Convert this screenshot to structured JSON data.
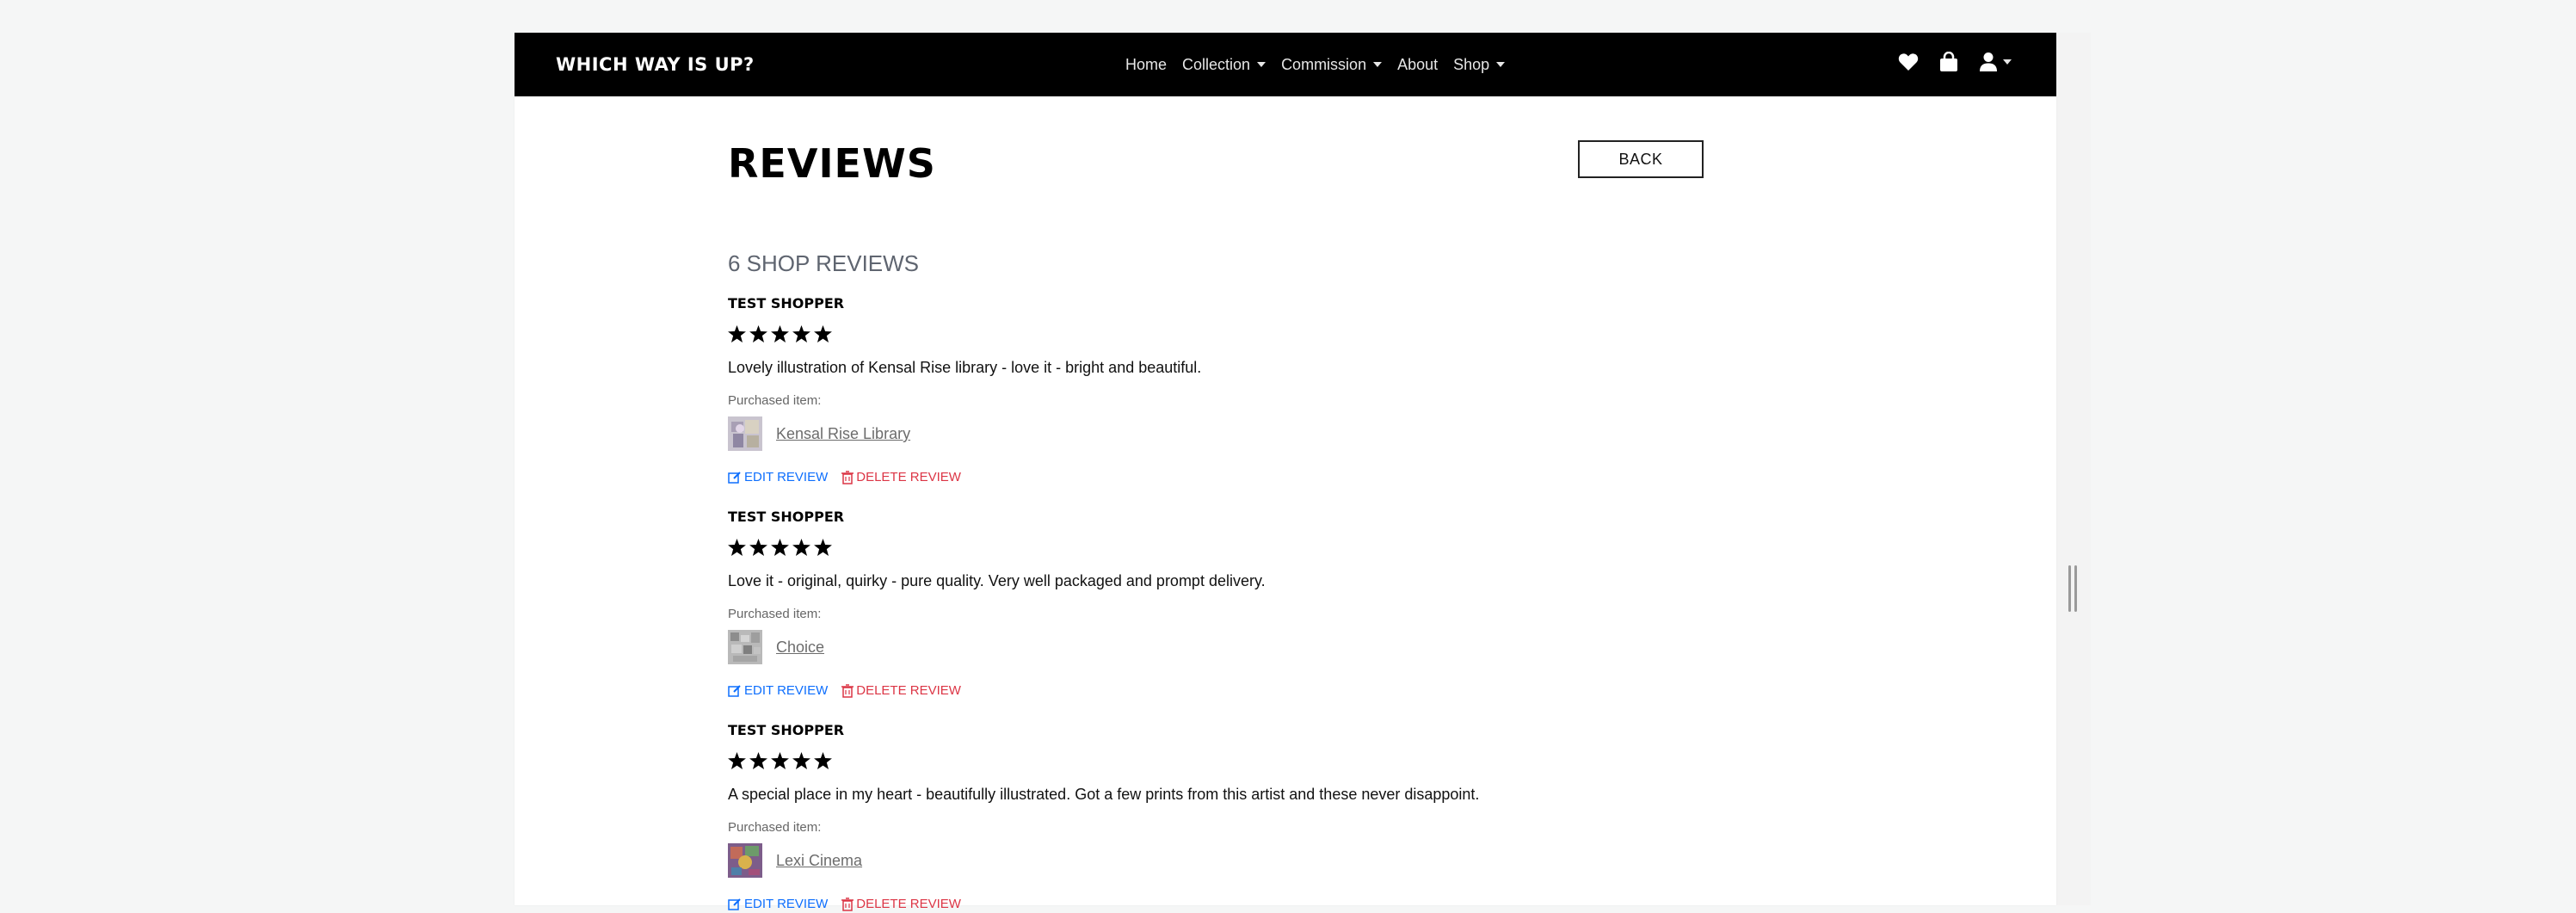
{
  "navbar": {
    "brand": "Which Way Is Up?",
    "links": [
      {
        "label": "Home",
        "dropdown": false
      },
      {
        "label": "Collection",
        "dropdown": true
      },
      {
        "label": "Commission",
        "dropdown": true
      },
      {
        "label": "About",
        "dropdown": false
      },
      {
        "label": "Shop",
        "dropdown": true
      }
    ],
    "icons": [
      "heart-icon",
      "shopping-bag-icon",
      "user-icon"
    ]
  },
  "page": {
    "title": "Reviews",
    "back_label": "BACK",
    "count_heading": "6 SHOP REVIEWS",
    "purchased_label": "Purchased item:",
    "edit_label": "EDIT REVIEW",
    "delete_label": "DELETE REVIEW"
  },
  "reviews": [
    {
      "reviewer": "Test Shopper",
      "rating": 5,
      "text": "Lovely illustration of Kensal Rise library - love it - bright and beautiful.",
      "item": "Kensal Rise Library"
    },
    {
      "reviewer": "Test Shopper",
      "rating": 5,
      "text": "Love it - original, quirky - pure quality. Very well packaged and prompt delivery.",
      "item": "Choice"
    },
    {
      "reviewer": "Test Shopper",
      "rating": 5,
      "text": "A special place in my heart - beautifully illustrated. Got a few prints from this artist and these never disappoint.",
      "item": "Lexi Cinema"
    }
  ],
  "colors": {
    "edit": "#0d6efd",
    "delete": "#dc3545",
    "navbar_bg": "#000000"
  }
}
